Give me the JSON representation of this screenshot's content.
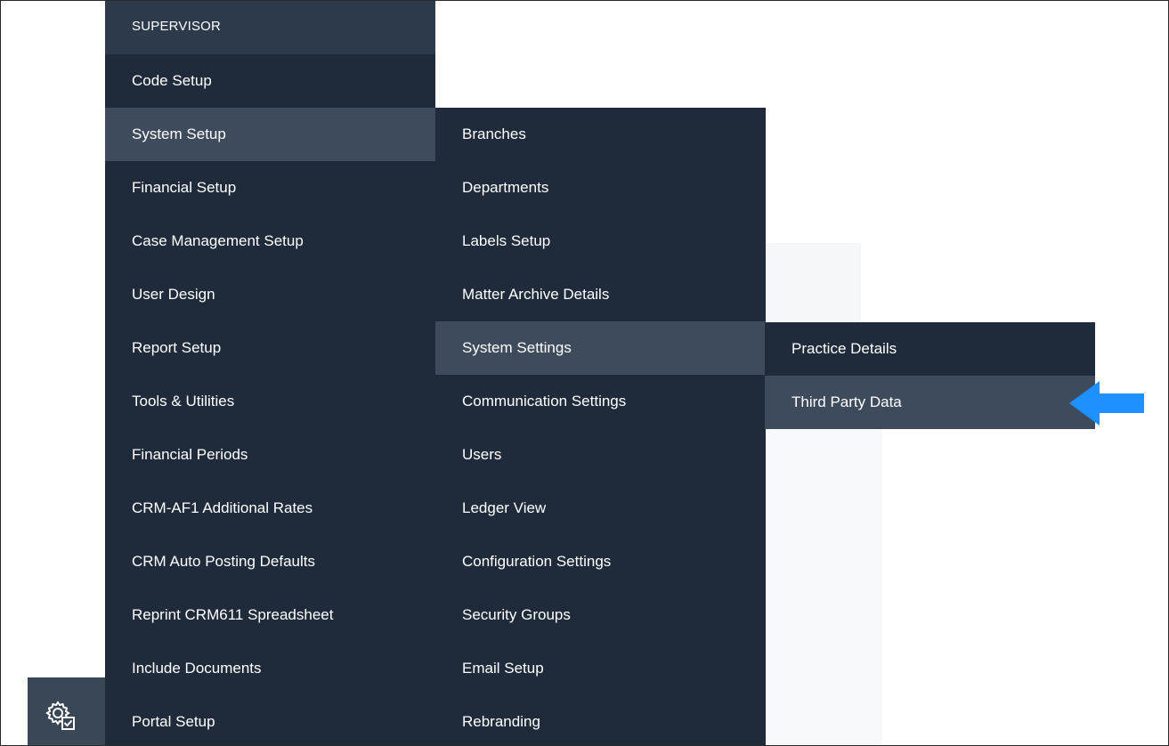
{
  "main_menu": {
    "header": "SUPERVISOR",
    "items": [
      {
        "label": "Code Setup"
      },
      {
        "label": "System Setup"
      },
      {
        "label": "Financial Setup"
      },
      {
        "label": "Case Management Setup"
      },
      {
        "label": "User Design"
      },
      {
        "label": "Report Setup"
      },
      {
        "label": "Tools & Utilities"
      },
      {
        "label": "Financial Periods"
      },
      {
        "label": "CRM-AF1 Additional Rates"
      },
      {
        "label": "CRM Auto Posting Defaults"
      },
      {
        "label": "Reprint CRM611 Spreadsheet"
      },
      {
        "label": "Include Documents"
      },
      {
        "label": "Portal Setup"
      }
    ]
  },
  "system_setup_menu": {
    "items": [
      {
        "label": "Branches"
      },
      {
        "label": "Departments"
      },
      {
        "label": "Labels Setup"
      },
      {
        "label": "Matter Archive Details"
      },
      {
        "label": "System Settings"
      },
      {
        "label": "Communication Settings"
      },
      {
        "label": "Users"
      },
      {
        "label": "Ledger View"
      },
      {
        "label": "Configuration Settings"
      },
      {
        "label": "Security Groups"
      },
      {
        "label": "Email Setup"
      },
      {
        "label": "Rebranding"
      }
    ]
  },
  "system_settings_menu": {
    "items": [
      {
        "label": "Practice Details"
      },
      {
        "label": "Third Party Data"
      }
    ]
  },
  "colors": {
    "menu_bg": "#1f2b3a",
    "menu_active": "#3d4b5c",
    "menu_header": "#2d3a4b",
    "arrow": "#1e90ff"
  },
  "icons": {
    "rail": "settings-gear-icon",
    "pointer": "arrow-left-icon"
  }
}
